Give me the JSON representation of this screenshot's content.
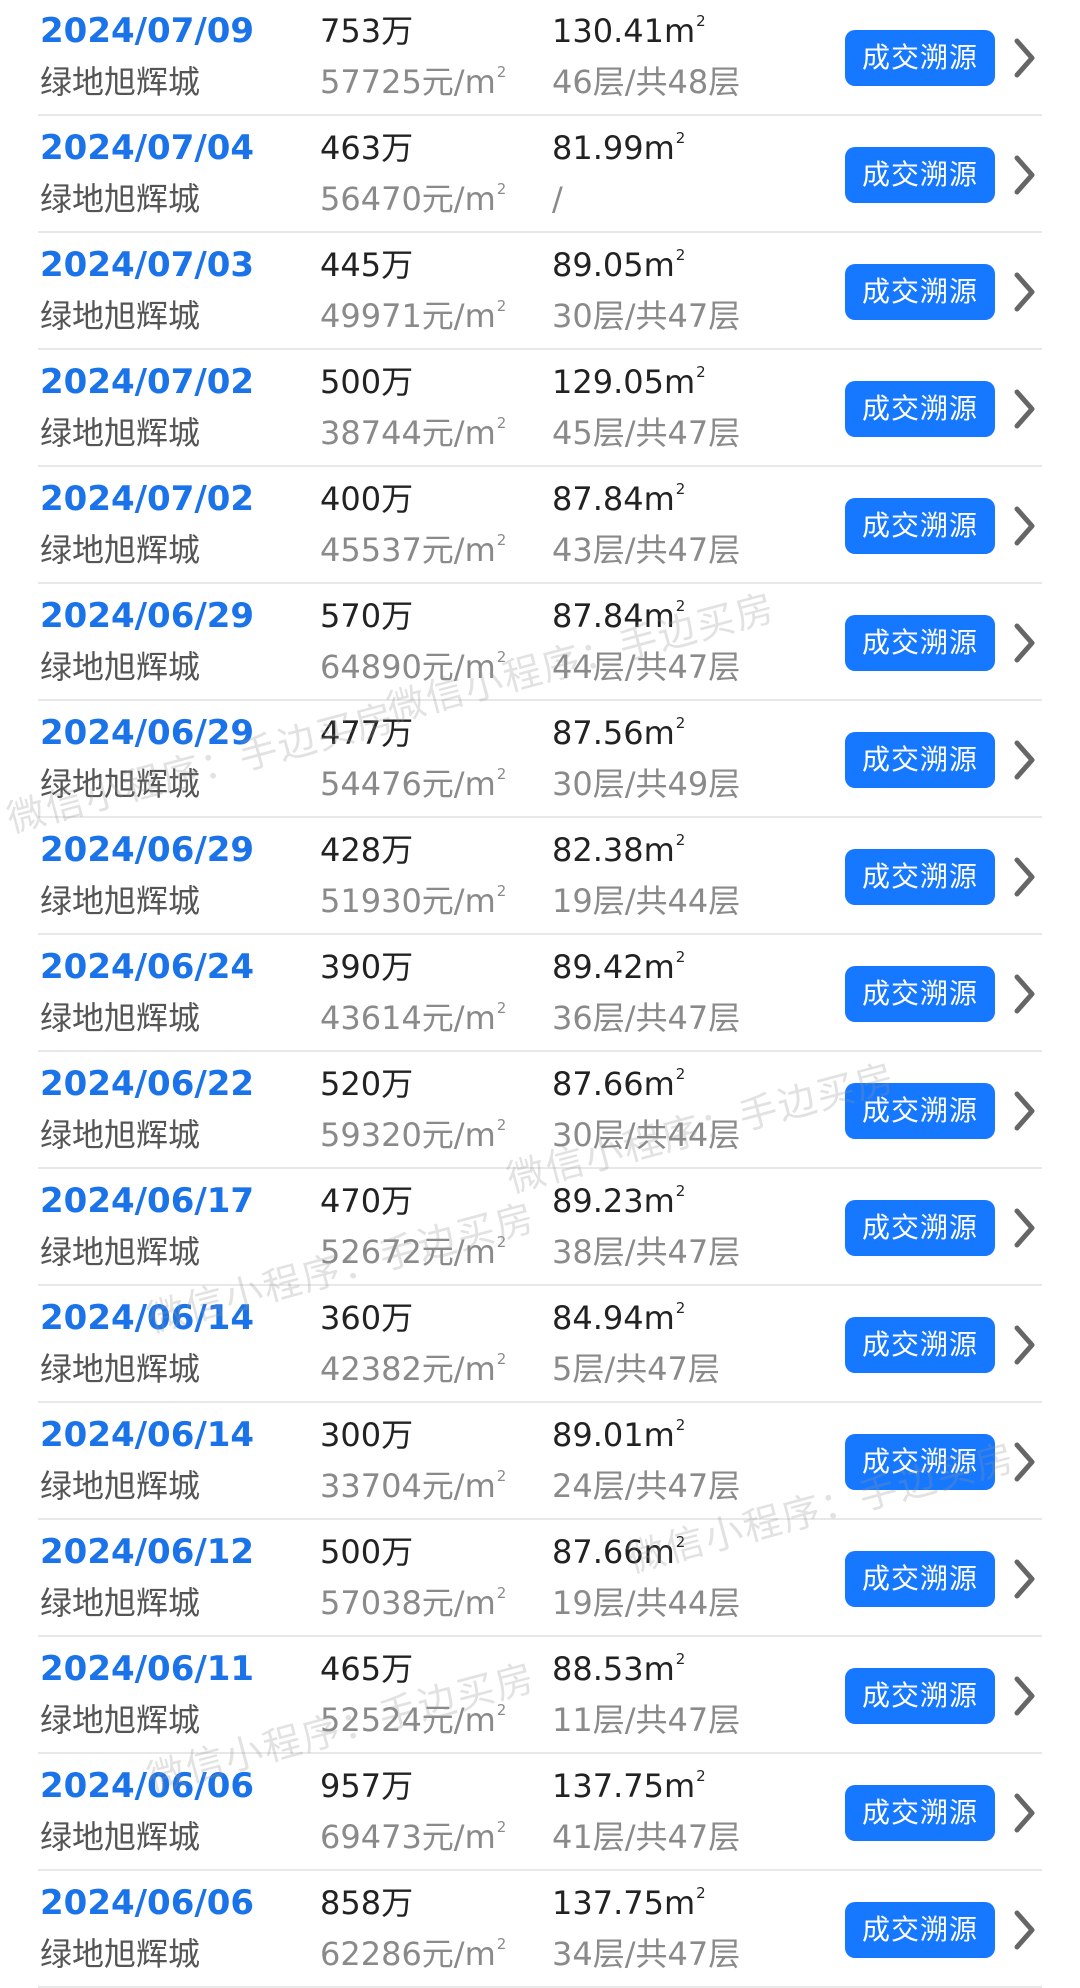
{
  "button_label": "成交溯源",
  "area_superscript": "2",
  "accent_color": "#1677ff",
  "date_color": "#1a73e8",
  "watermark_text": "微信小程序：手边买房",
  "rows": [
    {
      "date": "2024/07/09",
      "community": "绿地旭辉城",
      "total": "753万",
      "unit_price": "57725元/m",
      "area": "130.41m",
      "floor": "46层/共48层"
    },
    {
      "date": "2024/07/04",
      "community": "绿地旭辉城",
      "total": "463万",
      "unit_price": "56470元/m",
      "area": "81.99m",
      "floor": "/"
    },
    {
      "date": "2024/07/03",
      "community": "绿地旭辉城",
      "total": "445万",
      "unit_price": "49971元/m",
      "area": "89.05m",
      "floor": "30层/共47层"
    },
    {
      "date": "2024/07/02",
      "community": "绿地旭辉城",
      "total": "500万",
      "unit_price": "38744元/m",
      "area": "129.05m",
      "floor": "45层/共47层"
    },
    {
      "date": "2024/07/02",
      "community": "绿地旭辉城",
      "total": "400万",
      "unit_price": "45537元/m",
      "area": "87.84m",
      "floor": "43层/共47层"
    },
    {
      "date": "2024/06/29",
      "community": "绿地旭辉城",
      "total": "570万",
      "unit_price": "64890元/m",
      "area": "87.84m",
      "floor": "44层/共47层"
    },
    {
      "date": "2024/06/29",
      "community": "绿地旭辉城",
      "total": "477万",
      "unit_price": "54476元/m",
      "area": "87.56m",
      "floor": "30层/共49层"
    },
    {
      "date": "2024/06/29",
      "community": "绿地旭辉城",
      "total": "428万",
      "unit_price": "51930元/m",
      "area": "82.38m",
      "floor": "19层/共44层"
    },
    {
      "date": "2024/06/24",
      "community": "绿地旭辉城",
      "total": "390万",
      "unit_price": "43614元/m",
      "area": "89.42m",
      "floor": "36层/共47层"
    },
    {
      "date": "2024/06/22",
      "community": "绿地旭辉城",
      "total": "520万",
      "unit_price": "59320元/m",
      "area": "87.66m",
      "floor": "30层/共44层"
    },
    {
      "date": "2024/06/17",
      "community": "绿地旭辉城",
      "total": "470万",
      "unit_price": "52672元/m",
      "area": "89.23m",
      "floor": "38层/共47层"
    },
    {
      "date": "2024/06/14",
      "community": "绿地旭辉城",
      "total": "360万",
      "unit_price": "42382元/m",
      "area": "84.94m",
      "floor": "5层/共47层"
    },
    {
      "date": "2024/06/14",
      "community": "绿地旭辉城",
      "total": "300万",
      "unit_price": "33704元/m",
      "area": "89.01m",
      "floor": "24层/共47层"
    },
    {
      "date": "2024/06/12",
      "community": "绿地旭辉城",
      "total": "500万",
      "unit_price": "57038元/m",
      "area": "87.66m",
      "floor": "19层/共44层"
    },
    {
      "date": "2024/06/11",
      "community": "绿地旭辉城",
      "total": "465万",
      "unit_price": "52524元/m",
      "area": "88.53m",
      "floor": "11层/共47层"
    },
    {
      "date": "2024/06/06",
      "community": "绿地旭辉城",
      "total": "957万",
      "unit_price": "69473元/m",
      "area": "137.75m",
      "floor": "41层/共47层"
    },
    {
      "date": "2024/06/06",
      "community": "绿地旭辉城",
      "total": "858万",
      "unit_price": "62286元/m",
      "area": "137.75m",
      "floor": "34层/共47层"
    }
  ]
}
